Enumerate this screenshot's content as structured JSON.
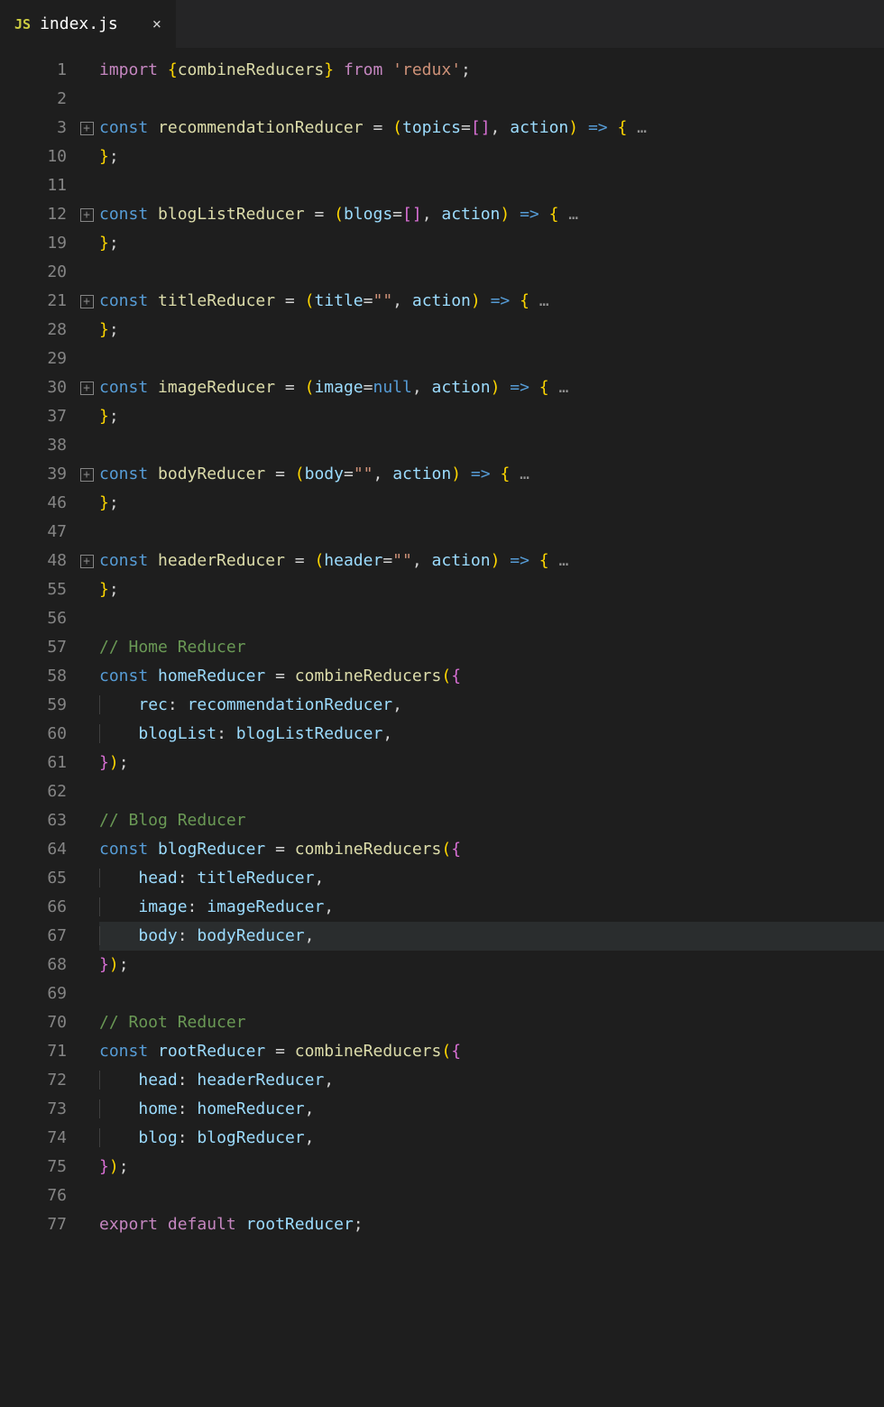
{
  "tab": {
    "icon_label": "JS",
    "filename": "index.js",
    "close": "×"
  },
  "lines": [
    {
      "n": 1,
      "fold": null,
      "t": [
        [
          "kw2",
          "import"
        ],
        [
          "pu",
          " "
        ],
        [
          "yl",
          "{"
        ],
        [
          "fn",
          "combineReducers"
        ],
        [
          "yl",
          "}"
        ],
        [
          "pu",
          " "
        ],
        [
          "kw2",
          "from"
        ],
        [
          "pu",
          " "
        ],
        [
          "st",
          "'redux'"
        ],
        [
          "pu",
          ";"
        ]
      ]
    },
    {
      "n": 2,
      "fold": null,
      "t": []
    },
    {
      "n": 3,
      "fold": "+",
      "t": [
        [
          "bl",
          "const"
        ],
        [
          "pu",
          " "
        ],
        [
          "fn",
          "recommendationReducer"
        ],
        [
          "pu",
          " "
        ],
        [
          "op",
          "="
        ],
        [
          "pu",
          " "
        ],
        [
          "yl",
          "("
        ],
        [
          "va",
          "topics"
        ],
        [
          "op",
          "="
        ],
        [
          "pk",
          "[]"
        ],
        [
          "pu",
          ", "
        ],
        [
          "va",
          "action"
        ],
        [
          "yl",
          ")"
        ],
        [
          "pu",
          " "
        ],
        [
          "bl",
          "=>"
        ],
        [
          "pu",
          " "
        ],
        [
          "yl",
          "{"
        ],
        [
          "dots",
          " …"
        ]
      ]
    },
    {
      "n": 10,
      "fold": null,
      "t": [
        [
          "yl",
          "}"
        ],
        [
          "pu",
          ";"
        ]
      ]
    },
    {
      "n": 11,
      "fold": null,
      "t": []
    },
    {
      "n": 12,
      "fold": "+",
      "t": [
        [
          "bl",
          "const"
        ],
        [
          "pu",
          " "
        ],
        [
          "fn",
          "blogListReducer"
        ],
        [
          "pu",
          " "
        ],
        [
          "op",
          "="
        ],
        [
          "pu",
          " "
        ],
        [
          "yl",
          "("
        ],
        [
          "va",
          "blogs"
        ],
        [
          "op",
          "="
        ],
        [
          "pk",
          "[]"
        ],
        [
          "pu",
          ", "
        ],
        [
          "va",
          "action"
        ],
        [
          "yl",
          ")"
        ],
        [
          "pu",
          " "
        ],
        [
          "bl",
          "=>"
        ],
        [
          "pu",
          " "
        ],
        [
          "yl",
          "{"
        ],
        [
          "dots",
          " …"
        ]
      ]
    },
    {
      "n": 19,
      "fold": null,
      "t": [
        [
          "yl",
          "}"
        ],
        [
          "pu",
          ";"
        ]
      ]
    },
    {
      "n": 20,
      "fold": null,
      "t": []
    },
    {
      "n": 21,
      "fold": "+",
      "t": [
        [
          "bl",
          "const"
        ],
        [
          "pu",
          " "
        ],
        [
          "fn",
          "titleReducer"
        ],
        [
          "pu",
          " "
        ],
        [
          "op",
          "="
        ],
        [
          "pu",
          " "
        ],
        [
          "yl",
          "("
        ],
        [
          "va",
          "title"
        ],
        [
          "op",
          "="
        ],
        [
          "st",
          "\"\""
        ],
        [
          "pu",
          ", "
        ],
        [
          "va",
          "action"
        ],
        [
          "yl",
          ")"
        ],
        [
          "pu",
          " "
        ],
        [
          "bl",
          "=>"
        ],
        [
          "pu",
          " "
        ],
        [
          "yl",
          "{"
        ],
        [
          "dots",
          " …"
        ]
      ]
    },
    {
      "n": 28,
      "fold": null,
      "t": [
        [
          "yl",
          "}"
        ],
        [
          "pu",
          ";"
        ]
      ]
    },
    {
      "n": 29,
      "fold": null,
      "t": []
    },
    {
      "n": 30,
      "fold": "+",
      "t": [
        [
          "bl",
          "const"
        ],
        [
          "pu",
          " "
        ],
        [
          "fn",
          "imageReducer"
        ],
        [
          "pu",
          " "
        ],
        [
          "op",
          "="
        ],
        [
          "pu",
          " "
        ],
        [
          "yl",
          "("
        ],
        [
          "va",
          "image"
        ],
        [
          "op",
          "="
        ],
        [
          "bl",
          "null"
        ],
        [
          "pu",
          ", "
        ],
        [
          "va",
          "action"
        ],
        [
          "yl",
          ")"
        ],
        [
          "pu",
          " "
        ],
        [
          "bl",
          "=>"
        ],
        [
          "pu",
          " "
        ],
        [
          "yl",
          "{"
        ],
        [
          "dots",
          " …"
        ]
      ]
    },
    {
      "n": 37,
      "fold": null,
      "t": [
        [
          "yl",
          "}"
        ],
        [
          "pu",
          ";"
        ]
      ]
    },
    {
      "n": 38,
      "fold": null,
      "t": []
    },
    {
      "n": 39,
      "fold": "+",
      "t": [
        [
          "bl",
          "const"
        ],
        [
          "pu",
          " "
        ],
        [
          "fn",
          "bodyReducer"
        ],
        [
          "pu",
          " "
        ],
        [
          "op",
          "="
        ],
        [
          "pu",
          " "
        ],
        [
          "yl",
          "("
        ],
        [
          "va",
          "body"
        ],
        [
          "op",
          "="
        ],
        [
          "st",
          "\"\""
        ],
        [
          "pu",
          ", "
        ],
        [
          "va",
          "action"
        ],
        [
          "yl",
          ")"
        ],
        [
          "pu",
          " "
        ],
        [
          "bl",
          "=>"
        ],
        [
          "pu",
          " "
        ],
        [
          "yl",
          "{"
        ],
        [
          "dots",
          " …"
        ]
      ]
    },
    {
      "n": 46,
      "fold": null,
      "t": [
        [
          "yl",
          "}"
        ],
        [
          "pu",
          ";"
        ]
      ]
    },
    {
      "n": 47,
      "fold": null,
      "t": []
    },
    {
      "n": 48,
      "fold": "+",
      "t": [
        [
          "bl",
          "const"
        ],
        [
          "pu",
          " "
        ],
        [
          "fn",
          "headerReducer"
        ],
        [
          "pu",
          " "
        ],
        [
          "op",
          "="
        ],
        [
          "pu",
          " "
        ],
        [
          "yl",
          "("
        ],
        [
          "va",
          "header"
        ],
        [
          "op",
          "="
        ],
        [
          "st",
          "\"\""
        ],
        [
          "pu",
          ", "
        ],
        [
          "va",
          "action"
        ],
        [
          "yl",
          ")"
        ],
        [
          "pu",
          " "
        ],
        [
          "bl",
          "=>"
        ],
        [
          "pu",
          " "
        ],
        [
          "yl",
          "{"
        ],
        [
          "dots",
          " …"
        ]
      ]
    },
    {
      "n": 55,
      "fold": null,
      "t": [
        [
          "yl",
          "}"
        ],
        [
          "pu",
          ";"
        ]
      ]
    },
    {
      "n": 56,
      "fold": null,
      "t": []
    },
    {
      "n": 57,
      "fold": null,
      "t": [
        [
          "cm",
          "// Home Reducer"
        ]
      ]
    },
    {
      "n": 58,
      "fold": null,
      "t": [
        [
          "bl",
          "const"
        ],
        [
          "pu",
          " "
        ],
        [
          "va",
          "homeReducer"
        ],
        [
          "pu",
          " "
        ],
        [
          "op",
          "="
        ],
        [
          "pu",
          " "
        ],
        [
          "fn",
          "combineReducers"
        ],
        [
          "yl",
          "("
        ],
        [
          "pk",
          "{"
        ]
      ]
    },
    {
      "n": 59,
      "fold": null,
      "guide": 1,
      "t": [
        [
          "pu",
          "    "
        ],
        [
          "va",
          "rec"
        ],
        [
          "pu",
          ": "
        ],
        [
          "va",
          "recommendationReducer"
        ],
        [
          "pu",
          ","
        ]
      ]
    },
    {
      "n": 60,
      "fold": null,
      "guide": 1,
      "t": [
        [
          "pu",
          "    "
        ],
        [
          "va",
          "blogList"
        ],
        [
          "pu",
          ": "
        ],
        [
          "va",
          "blogListReducer"
        ],
        [
          "pu",
          ","
        ]
      ]
    },
    {
      "n": 61,
      "fold": null,
      "t": [
        [
          "pk",
          "}"
        ],
        [
          "yl",
          ")"
        ],
        [
          "pu",
          ";"
        ]
      ]
    },
    {
      "n": 62,
      "fold": null,
      "t": []
    },
    {
      "n": 63,
      "fold": null,
      "t": [
        [
          "cm",
          "// Blog Reducer"
        ]
      ]
    },
    {
      "n": 64,
      "fold": null,
      "t": [
        [
          "bl",
          "const"
        ],
        [
          "pu",
          " "
        ],
        [
          "va",
          "blogReducer"
        ],
        [
          "pu",
          " "
        ],
        [
          "op",
          "="
        ],
        [
          "pu",
          " "
        ],
        [
          "fn",
          "combineReducers"
        ],
        [
          "yl",
          "("
        ],
        [
          "pk",
          "{"
        ]
      ]
    },
    {
      "n": 65,
      "fold": null,
      "guide": 1,
      "t": [
        [
          "pu",
          "    "
        ],
        [
          "va",
          "head"
        ],
        [
          "pu",
          ": "
        ],
        [
          "va",
          "titleReducer"
        ],
        [
          "pu",
          ","
        ]
      ]
    },
    {
      "n": 66,
      "fold": null,
      "guide": 1,
      "t": [
        [
          "pu",
          "    "
        ],
        [
          "va",
          "image"
        ],
        [
          "pu",
          ": "
        ],
        [
          "va",
          "imageReducer"
        ],
        [
          "pu",
          ","
        ]
      ]
    },
    {
      "n": 67,
      "fold": null,
      "guide": 1,
      "hl": true,
      "t": [
        [
          "pu",
          "    "
        ],
        [
          "va",
          "body"
        ],
        [
          "pu",
          ": "
        ],
        [
          "va",
          "bodyReducer"
        ],
        [
          "pu",
          ","
        ]
      ]
    },
    {
      "n": 68,
      "fold": null,
      "t": [
        [
          "pk",
          "}"
        ],
        [
          "yl",
          ")"
        ],
        [
          "pu",
          ";"
        ]
      ]
    },
    {
      "n": 69,
      "fold": null,
      "t": []
    },
    {
      "n": 70,
      "fold": null,
      "t": [
        [
          "cm",
          "// Root Reducer"
        ]
      ]
    },
    {
      "n": 71,
      "fold": null,
      "t": [
        [
          "bl",
          "const"
        ],
        [
          "pu",
          " "
        ],
        [
          "va",
          "rootReducer"
        ],
        [
          "pu",
          " "
        ],
        [
          "op",
          "="
        ],
        [
          "pu",
          " "
        ],
        [
          "fn",
          "combineReducers"
        ],
        [
          "yl",
          "("
        ],
        [
          "pk",
          "{"
        ]
      ]
    },
    {
      "n": 72,
      "fold": null,
      "guide": 1,
      "t": [
        [
          "pu",
          "    "
        ],
        [
          "va",
          "head"
        ],
        [
          "pu",
          ": "
        ],
        [
          "va",
          "headerReducer"
        ],
        [
          "pu",
          ","
        ]
      ]
    },
    {
      "n": 73,
      "fold": null,
      "guide": 1,
      "t": [
        [
          "pu",
          "    "
        ],
        [
          "va",
          "home"
        ],
        [
          "pu",
          ": "
        ],
        [
          "va",
          "homeReducer"
        ],
        [
          "pu",
          ","
        ]
      ]
    },
    {
      "n": 74,
      "fold": null,
      "guide": 1,
      "t": [
        [
          "pu",
          "    "
        ],
        [
          "va",
          "blog"
        ],
        [
          "pu",
          ": "
        ],
        [
          "va",
          "blogReducer"
        ],
        [
          "pu",
          ","
        ]
      ]
    },
    {
      "n": 75,
      "fold": null,
      "t": [
        [
          "pk",
          "}"
        ],
        [
          "yl",
          ")"
        ],
        [
          "pu",
          ";"
        ]
      ]
    },
    {
      "n": 76,
      "fold": null,
      "t": []
    },
    {
      "n": 77,
      "fold": null,
      "t": [
        [
          "kw2",
          "export"
        ],
        [
          "pu",
          " "
        ],
        [
          "kw2",
          "default"
        ],
        [
          "pu",
          " "
        ],
        [
          "va",
          "rootReducer"
        ],
        [
          "pu",
          ";"
        ]
      ]
    }
  ]
}
